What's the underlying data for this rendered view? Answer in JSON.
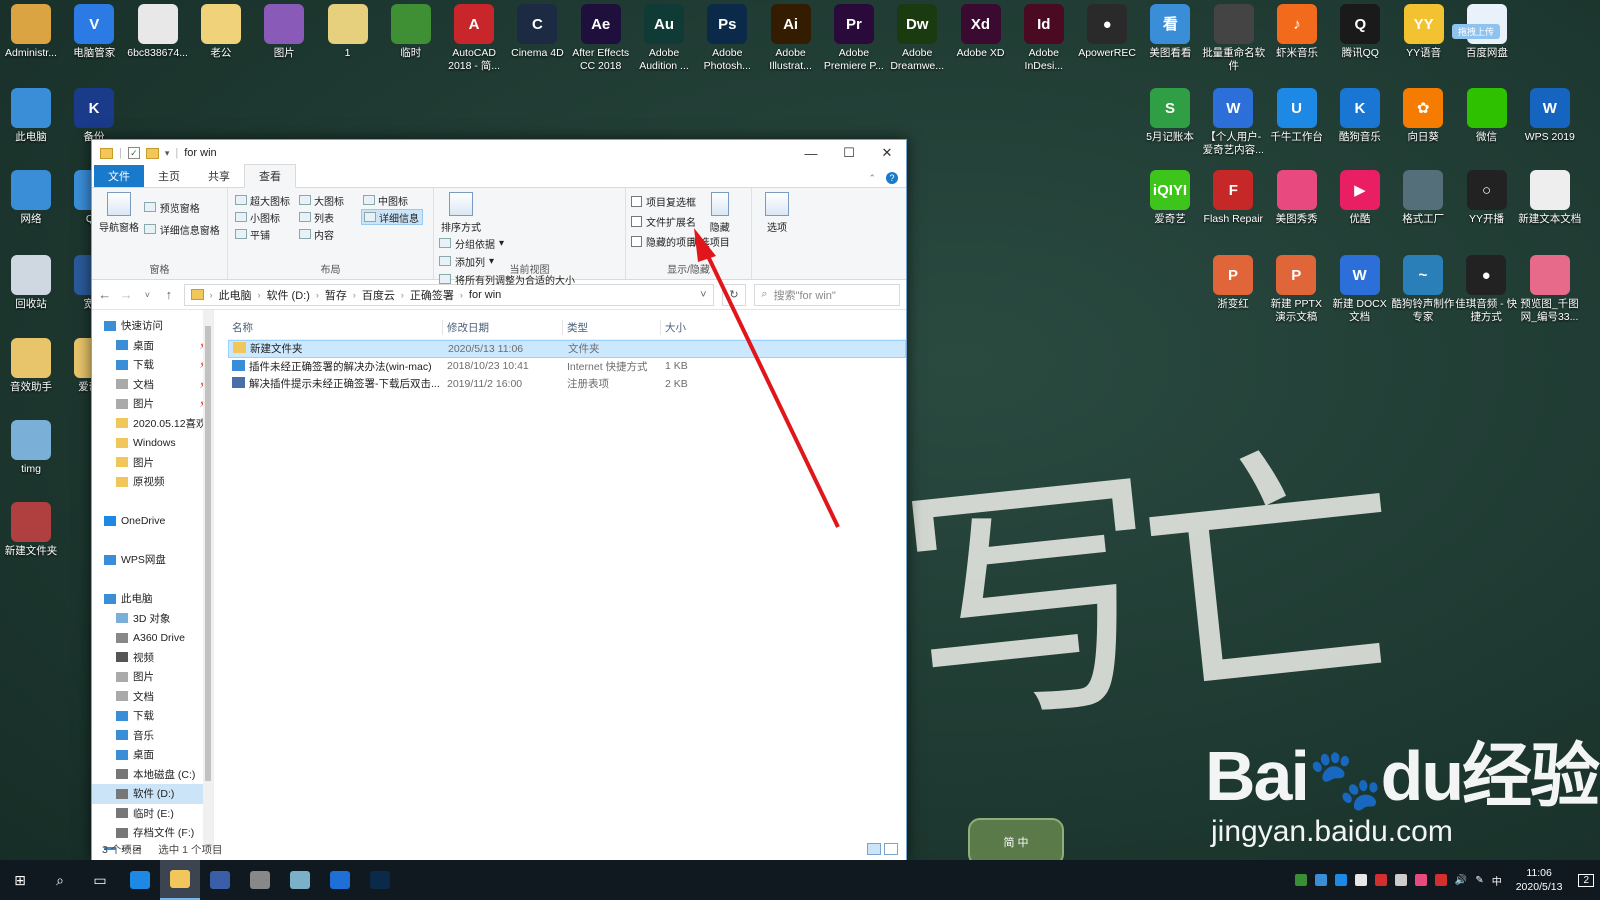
{
  "desktop": {
    "top_row": [
      {
        "label": "Administr...",
        "color": "#d9a441",
        "glyph": "user-folder-icon",
        "g": ""
      },
      {
        "label": "电脑管家",
        "color": "#2c7be5",
        "glyph": "shield-icon",
        "g": "V"
      },
      {
        "label": "6bc838674...",
        "color": "#e8e8e8",
        "glyph": "document-icon",
        "g": ""
      },
      {
        "label": "老公",
        "color": "#f0d27a",
        "glyph": "folder-icon",
        "g": ""
      },
      {
        "label": "图片",
        "color": "#8a5ab8",
        "glyph": "archive-icon",
        "g": ""
      },
      {
        "label": "1",
        "color": "#e6cf7d",
        "glyph": "folder-icon",
        "g": ""
      },
      {
        "label": "临时",
        "color": "#3f8f35",
        "glyph": "tree-icon",
        "g": ""
      },
      {
        "label": "AutoCAD 2018 - 简...",
        "color": "#c8262a",
        "glyph": "autocad-icon",
        "g": "A"
      },
      {
        "label": "Cinema 4D",
        "color": "#1c2a44",
        "glyph": "cinema4d-icon",
        "g": "C"
      },
      {
        "label": "After Effects CC 2018",
        "color": "#1f0f3d",
        "glyph": "aftereffects-icon",
        "g": "Ae"
      },
      {
        "label": "Adobe Audition ...",
        "color": "#0f3a35",
        "glyph": "audition-icon",
        "g": "Au"
      },
      {
        "label": "Adobe Photosh...",
        "color": "#0b2a4a",
        "glyph": "photoshop-icon",
        "g": "Ps"
      },
      {
        "label": "Adobe Illustrat...",
        "color": "#331c00",
        "glyph": "illustrator-icon",
        "g": "Ai"
      },
      {
        "label": "Adobe Premiere P...",
        "color": "#2a0a3a",
        "glyph": "premiere-icon",
        "g": "Pr"
      },
      {
        "label": "Adobe Dreamwe...",
        "color": "#1a3a10",
        "glyph": "dreamweaver-icon",
        "g": "Dw"
      },
      {
        "label": "Adobe XD",
        "color": "#3a0a30",
        "glyph": "xd-icon",
        "g": "Xd"
      },
      {
        "label": "Adobe InDesi...",
        "color": "#4a0a22",
        "glyph": "indesign-icon",
        "g": "Id"
      },
      {
        "label": "ApowerREC",
        "color": "#2a2a2a",
        "glyph": "record-icon",
        "g": "●"
      },
      {
        "label": "美图看看",
        "color": "#3a8ed8",
        "glyph": "meitu-viewer-icon",
        "g": "看"
      },
      {
        "label": "批量重命名软件",
        "color": "#444",
        "glyph": "rename-icon",
        "g": ""
      },
      {
        "label": "虾米音乐",
        "color": "#f26b1d",
        "glyph": "xiami-icon",
        "g": "♪"
      },
      {
        "label": "腾讯QQ",
        "color": "#1a1a1a",
        "glyph": "qq-icon",
        "g": "Q"
      },
      {
        "label": "YY语音",
        "color": "#f2c230",
        "glyph": "yy-icon",
        "g": "YY"
      },
      {
        "label": "百度网盘",
        "color": "#e9f2fb",
        "glyph": "baidu-netdisk-icon",
        "g": ""
      }
    ],
    "left_col": [
      {
        "label": "此电脑",
        "color": "#3a8ed8",
        "glyph": "computer-icon",
        "g": ""
      },
      {
        "label": "网络",
        "color": "#3a8ed8",
        "glyph": "network-icon",
        "g": ""
      },
      {
        "label": "回收站",
        "color": "#cfd8e0",
        "glyph": "recycle-bin-icon",
        "g": ""
      },
      {
        "label": "音效助手",
        "color": "#e8c56a",
        "glyph": "sound-helper-icon",
        "g": ""
      },
      {
        "label": "timg",
        "color": "#7ab0d8",
        "glyph": "image-icon",
        "g": ""
      },
      {
        "label": "新建文件夹",
        "color": "#b04040",
        "glyph": "archive-icon",
        "g": ""
      }
    ],
    "left_col2": [
      {
        "label": "备份",
        "color": "#1a3a8a",
        "glyph": "backup-icon",
        "g": "K"
      },
      {
        "label": "QQ",
        "color": "#3a8ed8",
        "glyph": "qq-browser-icon",
        "g": ""
      },
      {
        "label": "宽带",
        "color": "#2a5a9a",
        "glyph": "broadband-icon",
        "g": ""
      },
      {
        "label": "爱奇艺",
        "color": "#e8c56a",
        "glyph": "folder-icon",
        "g": ""
      }
    ],
    "right_row1": [
      {
        "label": "5月记账本",
        "color": "#2f9e44",
        "glyph": "spreadsheet-icon",
        "g": "S"
      },
      {
        "label": "【个人用户-爱奇艺内容...",
        "color": "#2c6fd8",
        "glyph": "word-doc-icon",
        "g": "W"
      },
      {
        "label": "千牛工作台",
        "color": "#1e88e5",
        "glyph": "qianniu-icon",
        "g": "U"
      },
      {
        "label": "酷狗音乐",
        "color": "#1976d2",
        "glyph": "kugou-icon",
        "g": "K"
      },
      {
        "label": "向日葵",
        "color": "#f57c00",
        "glyph": "sunflower-icon",
        "g": "✿"
      },
      {
        "label": "微信",
        "color": "#2dc100",
        "glyph": "wechat-icon",
        "g": ""
      },
      {
        "label": "WPS 2019",
        "color": "#1565c0",
        "glyph": "wps-icon",
        "g": "W"
      }
    ],
    "right_row2": [
      {
        "label": "爱奇艺",
        "color": "#3ec51c",
        "glyph": "iqiyi-icon",
        "g": "iQIYI"
      },
      {
        "label": "Flash Repair",
        "color": "#c62828",
        "glyph": "flash-icon",
        "g": "F"
      },
      {
        "label": "美图秀秀",
        "color": "#e84a7f",
        "glyph": "meitu-icon",
        "g": ""
      },
      {
        "label": "优酷",
        "color": "#e91e63",
        "glyph": "youku-icon",
        "g": "▶"
      },
      {
        "label": "格式工厂",
        "color": "#546e7a",
        "glyph": "format-factory-icon",
        "g": ""
      },
      {
        "label": "YY开播",
        "color": "#222",
        "glyph": "yy-live-icon",
        "g": "○"
      },
      {
        "label": "新建文本文档",
        "color": "#eeeeee",
        "glyph": "text-doc-icon",
        "g": ""
      }
    ],
    "right_row3": [
      {
        "label": "浙变红",
        "color": "#e0663a",
        "glyph": "ppt-icon",
        "g": "P"
      },
      {
        "label": "新建 PPTX 演示文稿",
        "color": "#e0663a",
        "glyph": "ppt-icon",
        "g": "P"
      },
      {
        "label": "新建 DOCX 文档",
        "color": "#2c6fd8",
        "glyph": "word-doc-icon",
        "g": "W"
      },
      {
        "label": "酷狗铃声制作专家",
        "color": "#2a7fb8",
        "glyph": "ringtone-icon",
        "g": "~"
      },
      {
        "label": "佳琪音频 - 快捷方式",
        "color": "#222",
        "glyph": "audio-icon",
        "g": "●"
      },
      {
        "label": "预览图_千图网_编号33...",
        "color": "#e86a8a",
        "glyph": "image-icon",
        "g": ""
      }
    ],
    "badge": "拖拽上传"
  },
  "window": {
    "title": "for win",
    "tabs": {
      "file": "文件",
      "home": "主页",
      "share": "共享",
      "view": "查看"
    },
    "ribbon": {
      "panes": {
        "nav": "导航窗格",
        "preview": "预览窗格",
        "details": "详细信息窗格",
        "group": "窗格"
      },
      "layout": {
        "items": [
          "超大图标",
          "大图标",
          "中图标",
          "小图标",
          "列表",
          "详细信息",
          "平铺",
          "内容"
        ],
        "group": "布局"
      },
      "current": {
        "sort": "排序方式",
        "groupby": "分组依据",
        "addcol": "添加列",
        "fit": "将所有列调整为合适的大小",
        "group": "当前视图"
      },
      "showhide": {
        "checkboxes": "项目复选框",
        "extensions": "文件扩展名",
        "hidden": "隐藏的项目",
        "hide": "隐藏",
        "selected": "所选项目",
        "group": "显示/隐藏"
      },
      "options": "选项"
    },
    "address": {
      "crumbs": [
        "此电脑",
        "软件 (D:)",
        "暂存",
        "百度云",
        "正确签署",
        "for win"
      ],
      "search_placeholder": "搜索\"for win\""
    },
    "nav": [
      {
        "label": "快速访问",
        "color": "#3a8ed8",
        "indent": 12,
        "pin": false,
        "sel": false
      },
      {
        "label": "桌面",
        "color": "#3a8ed8",
        "indent": 24,
        "pin": true,
        "sel": false
      },
      {
        "label": "下载",
        "color": "#3a8ed8",
        "indent": 24,
        "pin": true,
        "sel": false
      },
      {
        "label": "文档",
        "color": "#aaa",
        "indent": 24,
        "pin": true,
        "sel": false
      },
      {
        "label": "图片",
        "color": "#aaa",
        "indent": 24,
        "pin": true,
        "sel": false
      },
      {
        "label": "2020.05.12喜欢",
        "color": "#f1c65a",
        "indent": 24,
        "pin": false,
        "sel": false
      },
      {
        "label": "Windows",
        "color": "#f1c65a",
        "indent": 24,
        "pin": false,
        "sel": false
      },
      {
        "label": "图片",
        "color": "#f1c65a",
        "indent": 24,
        "pin": false,
        "sel": false
      },
      {
        "label": "原视频",
        "color": "#f1c65a",
        "indent": 24,
        "pin": false,
        "sel": false
      },
      {
        "label": "",
        "color": "transparent",
        "indent": 12,
        "pin": false,
        "sel": false
      },
      {
        "label": "OneDrive",
        "color": "#1e88e5",
        "indent": 12,
        "pin": false,
        "sel": false
      },
      {
        "label": "",
        "color": "transparent",
        "indent": 12,
        "pin": false,
        "sel": false
      },
      {
        "label": "WPS网盘",
        "color": "#3a8ed8",
        "indent": 12,
        "pin": false,
        "sel": false
      },
      {
        "label": "",
        "color": "transparent",
        "indent": 12,
        "pin": false,
        "sel": false
      },
      {
        "label": "此电脑",
        "color": "#3a8ed8",
        "indent": 12,
        "pin": false,
        "sel": false
      },
      {
        "label": "3D 对象",
        "color": "#7ab0d8",
        "indent": 24,
        "pin": false,
        "sel": false
      },
      {
        "label": "A360 Drive",
        "color": "#888",
        "indent": 24,
        "pin": false,
        "sel": false
      },
      {
        "label": "视频",
        "color": "#555",
        "indent": 24,
        "pin": false,
        "sel": false
      },
      {
        "label": "图片",
        "color": "#aaa",
        "indent": 24,
        "pin": false,
        "sel": false
      },
      {
        "label": "文档",
        "color": "#aaa",
        "indent": 24,
        "pin": false,
        "sel": false
      },
      {
        "label": "下载",
        "color": "#3a8ed8",
        "indent": 24,
        "pin": false,
        "sel": false
      },
      {
        "label": "音乐",
        "color": "#3a8ed8",
        "indent": 24,
        "pin": false,
        "sel": false
      },
      {
        "label": "桌面",
        "color": "#3a8ed8",
        "indent": 24,
        "pin": false,
        "sel": false
      },
      {
        "label": "本地磁盘 (C:)",
        "color": "#777",
        "indent": 24,
        "pin": false,
        "sel": false
      },
      {
        "label": "软件 (D:)",
        "color": "#777",
        "indent": 24,
        "pin": false,
        "sel": true
      },
      {
        "label": "临时 (E:)",
        "color": "#777",
        "indent": 24,
        "pin": false,
        "sel": false
      },
      {
        "label": "存档文件 (F:)",
        "color": "#777",
        "indent": 24,
        "pin": false,
        "sel": false
      },
      {
        "label": "网络",
        "color": "#3a8ed8",
        "indent": 12,
        "pin": false,
        "sel": false
      }
    ],
    "columns": [
      "名称",
      "修改日期",
      "类型",
      "大小"
    ],
    "files": [
      {
        "name": "新建文件夹",
        "date": "2020/5/13 11:06",
        "type": "文件夹",
        "size": "",
        "icon": "#f1c65a",
        "sel": true
      },
      {
        "name": "插件未经正确签署的解决办法(win-mac)",
        "date": "2018/10/23 10:41",
        "type": "Internet 快捷方式",
        "size": "1 KB",
        "icon": "#3a8ed8",
        "sel": false
      },
      {
        "name": "解决插件提示未经正确签署-下载后双击...",
        "date": "2019/11/2 16:00",
        "type": "注册表项",
        "size": "2 KB",
        "icon": "#4a6fa8",
        "sel": false
      }
    ],
    "status": {
      "count": "3 个项目",
      "selected": "选中 1 个项目"
    }
  },
  "watermark": {
    "brand": "Bai",
    "suffix": "du经验",
    "url": "jingyan.baidu.com"
  },
  "ime": {
    "label": "简 中"
  },
  "taskbar": {
    "apps": [
      {
        "name": "edge",
        "color": "#1e88e5",
        "active": false
      },
      {
        "name": "explorer",
        "color": "#f1c65a",
        "active": true
      },
      {
        "name": "kk",
        "color": "#3a5fa8",
        "active": false
      },
      {
        "name": "netease",
        "color": "#888",
        "active": false
      },
      {
        "name": "notes",
        "color": "#7ab0c8",
        "active": false
      },
      {
        "name": "wps",
        "color": "#1e6fd8",
        "active": false
      },
      {
        "name": "photoshop",
        "color": "#0b2a4a",
        "active": false
      }
    ],
    "tray_lang": "中",
    "time": "11:06",
    "date": "2020/5/13",
    "notif": "2"
  }
}
